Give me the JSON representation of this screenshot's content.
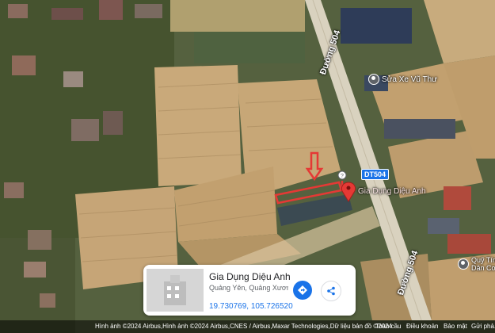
{
  "map": {
    "roads": [
      {
        "name": "Đường 504"
      },
      {
        "name": "Đường 504"
      }
    ],
    "route_badge": "DT504",
    "pois": [
      {
        "name": "Sửa Xe Vũ Thư"
      },
      {
        "name": "Gia Dụng Diệu Anh"
      },
      {
        "name": "Quỹ Tín Dân Cơ"
      }
    ]
  },
  "place_card": {
    "title": "Gia Dụng Diệu Anh",
    "address": "Quảng Yên, Quảng Xươn...",
    "coordinates": "19.730769, 105.726520",
    "directions_icon": "directions-icon",
    "share_icon": "share-icon"
  },
  "footer": {
    "attribution": "Hình ảnh ©2024 Airbus,Hình ảnh ©2024 Airbus,CNES / Airbus,Maxar Technologies,Dữ liệu bản đồ ©2024",
    "links": [
      "Toàn cầu",
      "Điều khoản",
      "Bảo mật",
      "Gửi phả..."
    ]
  },
  "colors": {
    "field_light": "#c9a97a",
    "field_dark": "#a98a5e",
    "vegetation": "#3d5a33",
    "road": "#d9d2bf",
    "pin": "#e53935",
    "accent": "#1a73e8",
    "annotation": "#e53935"
  }
}
